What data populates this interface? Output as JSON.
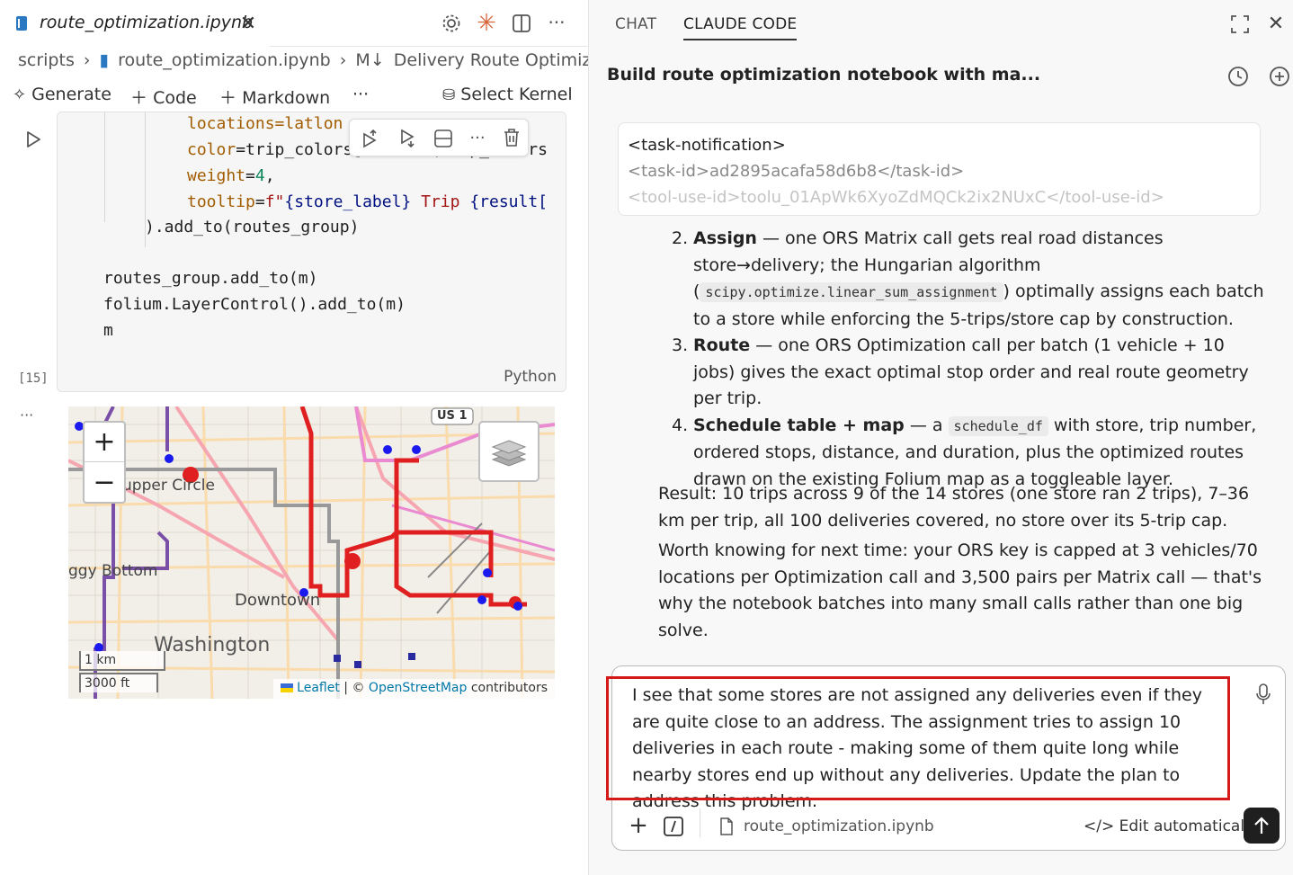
{
  "editor": {
    "tab": {
      "filename": "route_optimization.ipynb"
    },
    "breadcrumb": {
      "folder": "scripts",
      "file": "route_optimization.ipynb",
      "heading": "Delivery Route Optimization"
    },
    "toolbar": {
      "generate": "Generate",
      "code": "Code",
      "markdown": "Markdown",
      "more": "···",
      "select_kernel": "Select Kernel"
    },
    "cell": {
      "language": "Python",
      "execution_count": "[15]",
      "code": {
        "l1": "locations=latlon",
        "l2a": "color",
        "l2b": "=trip_colors[i % len(trip_colors",
        "l3a": "weight",
        "l3b": "=",
        "l3c": "4",
        "l3d": ",",
        "l4a": "tooltip",
        "l4b": "=",
        "l4c": "f\"",
        "l4d": "{store_label}",
        "l4e": " Trip ",
        "l4f": "{result[",
        "l5": ").add_to(routes_group)",
        "l6": "routes_group.add_to(m)",
        "l7": "folium.LayerControl().add_to(m)",
        "l8": "m"
      }
    },
    "output_more": "···",
    "map": {
      "zoom_in": "+",
      "zoom_out": "−",
      "labels": {
        "upper": "upper Circle",
        "foggy": "ggy Bottom",
        "downtown": "Downtown",
        "washington": "Washington",
        "us1": "US 1"
      },
      "scale_metric": "1 km",
      "scale_imperial": "3000 ft",
      "attribution": {
        "leaflet": "Leaflet",
        "sep": " | © ",
        "osm": "OpenStreetMap",
        "tail": " contributors"
      }
    }
  },
  "chat": {
    "tabs": {
      "chat": "CHAT",
      "claude_code": "CLAUDE CODE"
    },
    "title": "Build route optimization notebook with ma...",
    "notification": {
      "l1": "<task-notification>",
      "l2": "<task-id>ad2895acafa58d6b8</task-id>",
      "l3": "<tool-use-id>toolu_01ApWk6XyoZdMQCk2ix2NUxC</tool-use-id>"
    },
    "steps": [
      {
        "num": "2.",
        "title": "Assign",
        "t1": " — one ORS Matrix call gets real road distances store→delivery; the Hungarian algorithm (",
        "code": "scipy.optimize.linear_sum_assignment",
        "t2": ") optimally assigns each batch to a store while enforcing the 5-trips/store cap by construction."
      },
      {
        "num": "3.",
        "title": "Route",
        "t1": " — one ORS Optimization call per batch (1 vehicle + 10 jobs) gives the exact optimal stop order and real route geometry per trip."
      },
      {
        "num": "4.",
        "title": "Schedule table + map",
        "t1": " — a ",
        "code": "schedule_df",
        "t2": " with store, trip number, ordered stops, distance, and duration, plus the optimized routes drawn on the existing Folium map as a toggleable layer."
      }
    ],
    "result": "Result: 10 trips across 9 of the 14 stores (one store ran 2 trips), 7–36 km per trip, all 100 deliveries covered, no store over its 5-trip cap.",
    "worth": "Worth knowing for next time: your ORS key is capped at 3 vehicles/70 locations per Optimization call and 3,500 pairs per Matrix call — that's why the notebook batches into many small calls rather than one big solve.",
    "composer": {
      "text": "I see that some stores are not assigned any deliveries even if they are quite close to an address. The assignment tries to assign 10 deliveries in each route - making some of them quite long while nearby stores end up without any deliveries. Update the plan to address this problem.",
      "context_file": "route_optimization.ipynb",
      "mode": "Edit automatically"
    }
  }
}
